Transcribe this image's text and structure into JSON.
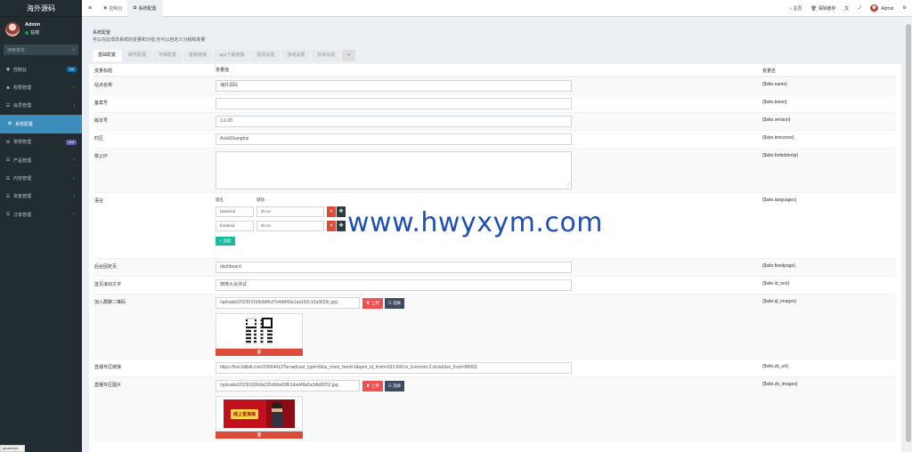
{
  "app": {
    "logo": "海外源码"
  },
  "user": {
    "name": "Admin",
    "status": "在线"
  },
  "sidebar": {
    "search_placeholder": "搜索菜单",
    "items": [
      {
        "icon": "dashboard-icon",
        "glyph": "◉",
        "label": "控制台",
        "badge": "hot",
        "badge_color": "blue"
      },
      {
        "icon": "users-icon",
        "glyph": "☻",
        "label": "权限管理",
        "chevron": "‹"
      },
      {
        "icon": "list-icon",
        "glyph": "☰",
        "label": "会员管理",
        "chevron": "‹"
      },
      {
        "icon": "gear-icon",
        "glyph": "✿",
        "label": "系统配置",
        "active": true
      },
      {
        "icon": "cogs-icon",
        "glyph": "⚙",
        "label": "常规管理",
        "badge": "new",
        "badge_color": "purple"
      },
      {
        "icon": "list-icon",
        "glyph": "☰",
        "label": "产品管理",
        "chevron": "‹"
      },
      {
        "icon": "list-icon",
        "glyph": "☰",
        "label": "内容管理",
        "chevron": "‹"
      },
      {
        "icon": "list-icon",
        "glyph": "☰",
        "label": "资金管理",
        "chevron": "‹"
      },
      {
        "icon": "list-icon",
        "glyph": "☰",
        "label": "订单管理",
        "chevron": "‹"
      }
    ]
  },
  "topbar": {
    "tabs": [
      {
        "label": "控制台",
        "active": false
      },
      {
        "label": "系统配置",
        "active": true
      }
    ],
    "home": "主页",
    "clear_cache": "清除缓存",
    "user_name": "Admin"
  },
  "header": {
    "title": "系统配置",
    "desc": "可以在此增改系统的变量和分组,也可以自定义分组和变量",
    "tabs": [
      "基础配置",
      "邮件配置",
      "字典配置",
      "客服链接",
      "app下载链接",
      "提现设置",
      "游戏设置",
      "抢单设置",
      "+"
    ]
  },
  "table": {
    "col_title": "变量标题",
    "col_value": "变量值",
    "col_name": "变量名",
    "rows": {
      "site_name": {
        "title": "站点名称",
        "value": "海外源码",
        "var": "{$site.name}"
      },
      "beian": {
        "title": "备案号",
        "value": "",
        "var": "{$site.beian}"
      },
      "version": {
        "title": "版本号",
        "value": "1.0.20",
        "var": "{$site.version}"
      },
      "timezone": {
        "title": "时区",
        "value": "Asia/Shanghai",
        "var": "{$site.timezone}"
      },
      "forbiddenip": {
        "title": "禁止IP",
        "value": "",
        "var": "{$site.forbiddenip}"
      },
      "languages": {
        "title": "语言",
        "key_label": "键名",
        "value_label": "键值",
        "items": [
          {
            "key": "backend",
            "value": "zh-cn"
          },
          {
            "key": "frontend",
            "value": "zh-cn"
          }
        ],
        "add_label": "追加",
        "var": "{$site.languages}"
      },
      "fixedpage": {
        "title": "后台固定页",
        "value": "dashboard",
        "var": "{$site.fixedpage}"
      },
      "ld_text": {
        "title": "首页滚动文字",
        "value": "撩撩大会测试",
        "var": "{$site.ld_text}"
      },
      "ql_images": {
        "title": "加入群聊二维码",
        "value": "/uploads/20230310/b9df6cf7e4d843a1aa152c12a3629c.jpg",
        "upload": "上传",
        "select": "选择",
        "delete": "🗑",
        "var": "{$site.ql_images}"
      },
      "zb_url": {
        "title": "直播专区链接",
        "value": "https://live.bilibili.com/23664413?broadcast_type=0&is_room_feed=1&spm_id_from=333.999.to_liveroom.0.click&live_from=86002",
        "var": "{$site.zb_url}"
      },
      "zb_images": {
        "title": "直播专区图片",
        "value": "/uploads/20230309/da235d0da60f61dad48a5a3db8f252.jpg",
        "upload": "上传",
        "select": "选择",
        "delete": "🗑",
        "var": "{$site.zb_images}",
        "banner_text": "线上宣淘淘"
      }
    }
  },
  "watermark": "www.hwyxym.com",
  "statusbar": "javascript:"
}
